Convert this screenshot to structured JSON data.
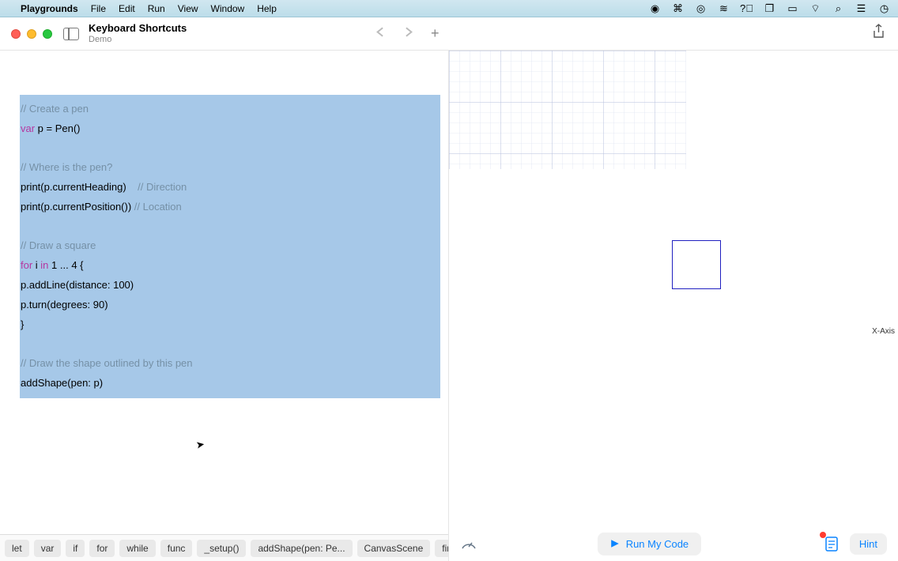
{
  "menubar": {
    "apple": "",
    "app": "Playgrounds",
    "items": [
      "File",
      "Edit",
      "Run",
      "View",
      "Window",
      "Help"
    ]
  },
  "toolbar": {
    "title": "Keyboard Shortcuts",
    "subtitle": "Demo"
  },
  "code": {
    "l1": "// Create a pen",
    "l2a": "var",
    "l2b": " p = Pen()",
    "l3": "// Where is the pen?",
    "l4a": "print(p.currentHeading)    ",
    "l4b": "// Direction",
    "l5a": "print(p.currentPosition()) ",
    "l5b": "// Location",
    "l6": "// Draw a square",
    "l7a": "for",
    "l7b": " i ",
    "l7c": "in",
    "l7d": " 1 ... 4 {",
    "l8": "p.addLine(distance: 100)",
    "l9": "p.turn(degrees: 90)",
    "l10": "}",
    "l11": "// Draw the shape outlined by this pen",
    "l12": "addShape(pen: p)"
  },
  "snippets": [
    "let",
    "var",
    "if",
    "for",
    "while",
    "func",
    "_setup()",
    "addShape(pen: Pe...",
    "CanvasScene",
    "findU"
  ],
  "canvas": {
    "axis_label": "X-Axis"
  },
  "bottom": {
    "run": "Run My Code",
    "hint": "Hint"
  }
}
